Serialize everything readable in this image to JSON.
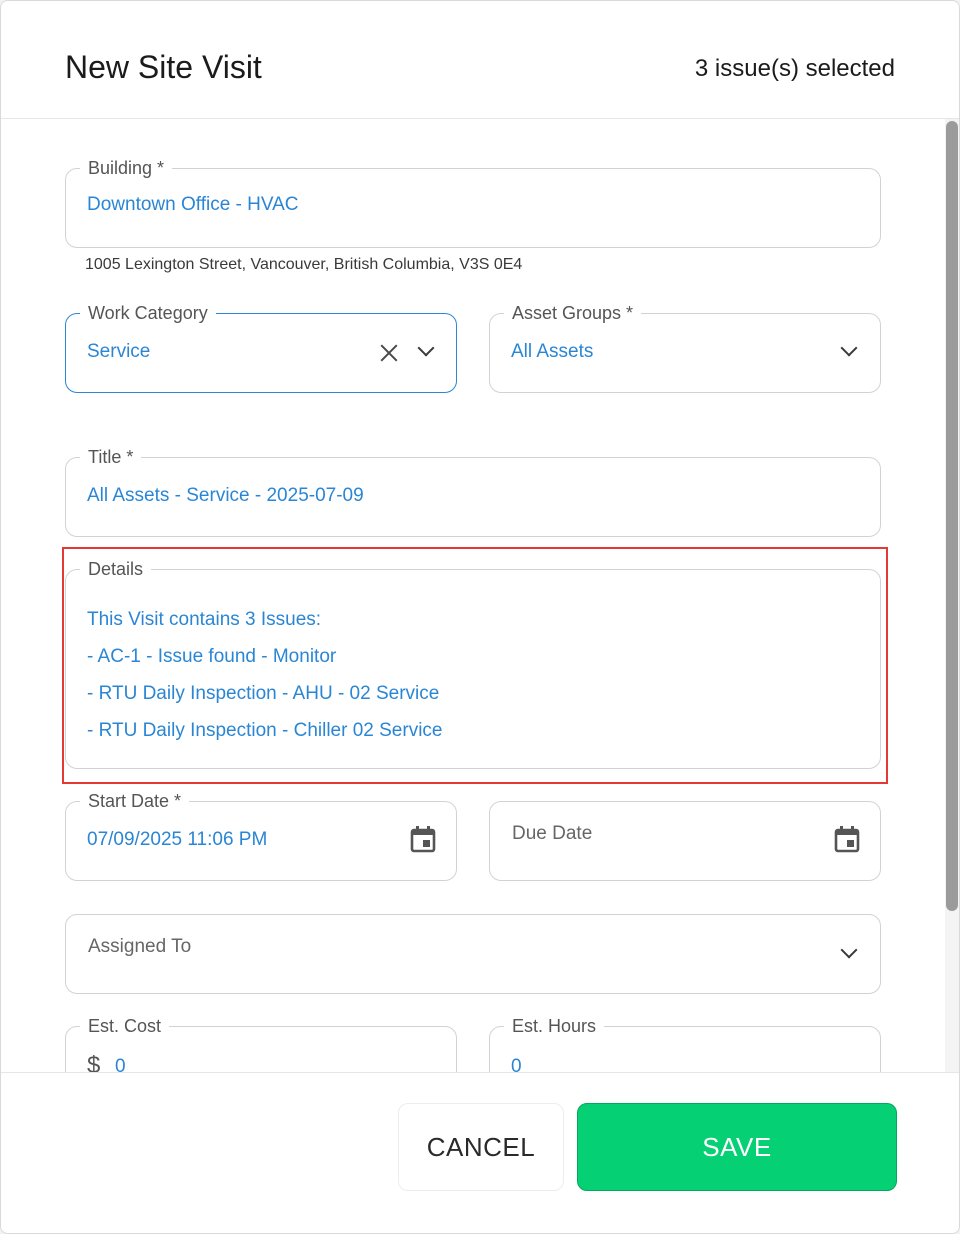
{
  "dialog": {
    "title": "New Site Visit",
    "selected_count": "3 issue(s) selected"
  },
  "form": {
    "building": {
      "label": "Building *",
      "value": "Downtown Office - HVAC",
      "address": "1005 Lexington Street, Vancouver, British Columbia, V3S 0E4"
    },
    "work_category": {
      "label": "Work Category",
      "value": "Service"
    },
    "asset_groups": {
      "label": "Asset Groups *",
      "value": "All Assets"
    },
    "title": {
      "label": "Title *",
      "value": "All Assets - Service - 2025-07-09"
    },
    "details": {
      "label": "Details",
      "lines": [
        "This Visit contains 3 Issues:",
        "- AC-1 - Issue found - Monitor",
        "- RTU Daily Inspection - AHU - 02 Service",
        "- RTU Daily Inspection - Chiller 02 Service"
      ]
    },
    "start_date": {
      "label": "Start Date *",
      "value": "07/09/2025 11:06 PM"
    },
    "due_date": {
      "placeholder": "Due Date"
    },
    "assigned_to": {
      "placeholder": "Assigned To"
    },
    "est_cost": {
      "label": "Est. Cost",
      "currency": "$",
      "value": "0"
    },
    "est_hours": {
      "label": "Est. Hours",
      "value": "0"
    }
  },
  "footer": {
    "cancel_label": "CANCEL",
    "save_label": "SAVE"
  },
  "colors": {
    "accent": "#2a86d4",
    "save": "#06d074",
    "highlight": "#e53935"
  }
}
